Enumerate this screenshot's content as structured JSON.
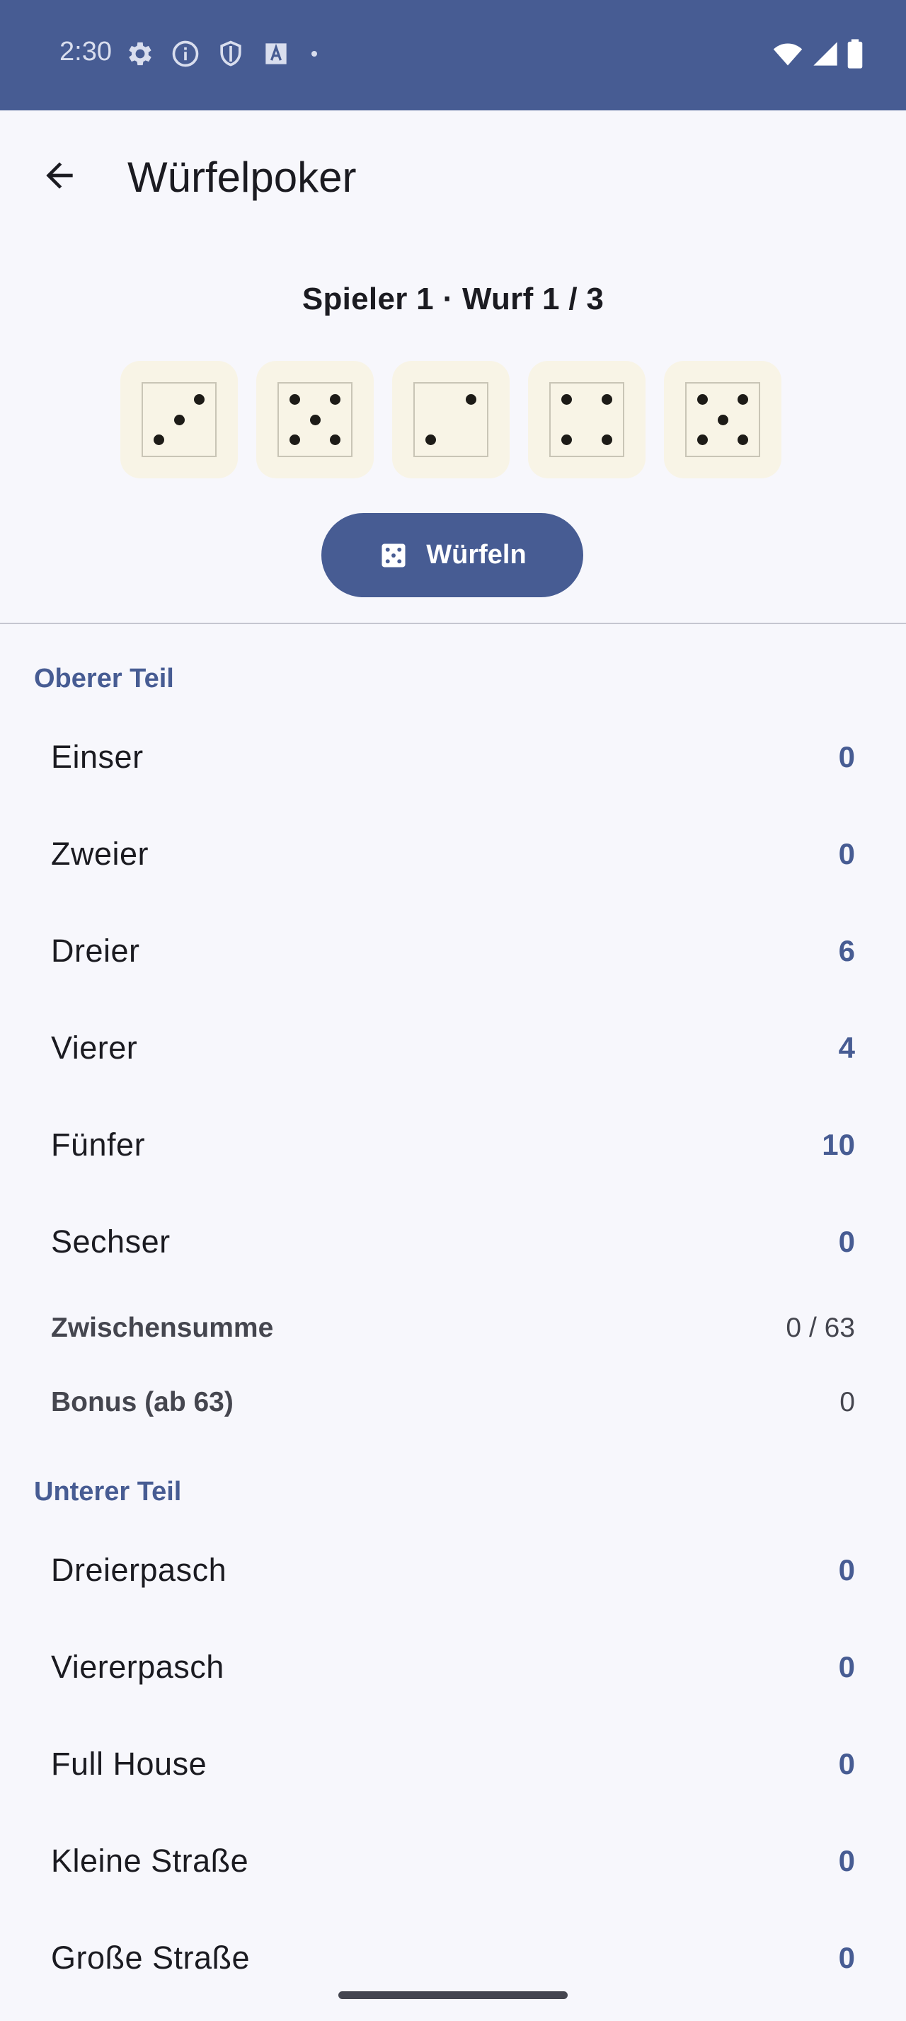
{
  "status_bar": {
    "time": "2:30",
    "icons": [
      "gear-icon",
      "info-icon",
      "shield-icon",
      "font-a-icon",
      "dot-icon"
    ],
    "right_icons": [
      "wifi-icon",
      "signal-icon",
      "battery-icon"
    ]
  },
  "app_bar": {
    "title": "Würfelpoker",
    "back_icon": "arrow-back-icon"
  },
  "game": {
    "player_info": "Spieler 1 · Wurf 1 / 3",
    "dice": [
      3,
      5,
      2,
      4,
      5
    ],
    "roll_button": {
      "label": "Würfeln",
      "icon": "dice-icon"
    }
  },
  "upper": {
    "title": "Oberer Teil",
    "rows": [
      {
        "label": "Einser",
        "value": "0"
      },
      {
        "label": "Zweier",
        "value": "0"
      },
      {
        "label": "Dreier",
        "value": "6"
      },
      {
        "label": "Vierer",
        "value": "4"
      },
      {
        "label": "Fünfer",
        "value": "10"
      },
      {
        "label": "Sechser",
        "value": "0"
      }
    ],
    "subtotal_label": "Zwischensumme",
    "subtotal_value": "0 / 63",
    "bonus_label": "Bonus (ab 63)",
    "bonus_value": "0"
  },
  "lower": {
    "title": "Unterer Teil",
    "rows": [
      {
        "label": "Dreierpasch",
        "value": "0"
      },
      {
        "label": "Viererpasch",
        "value": "0"
      },
      {
        "label": "Full House",
        "value": "0"
      },
      {
        "label": "Kleine Straße",
        "value": "0"
      },
      {
        "label": "Große Straße",
        "value": "0"
      }
    ]
  },
  "colors": {
    "primary": "#475c93",
    "die_background": "#f8f4e6",
    "background": "#f7f7fc"
  }
}
